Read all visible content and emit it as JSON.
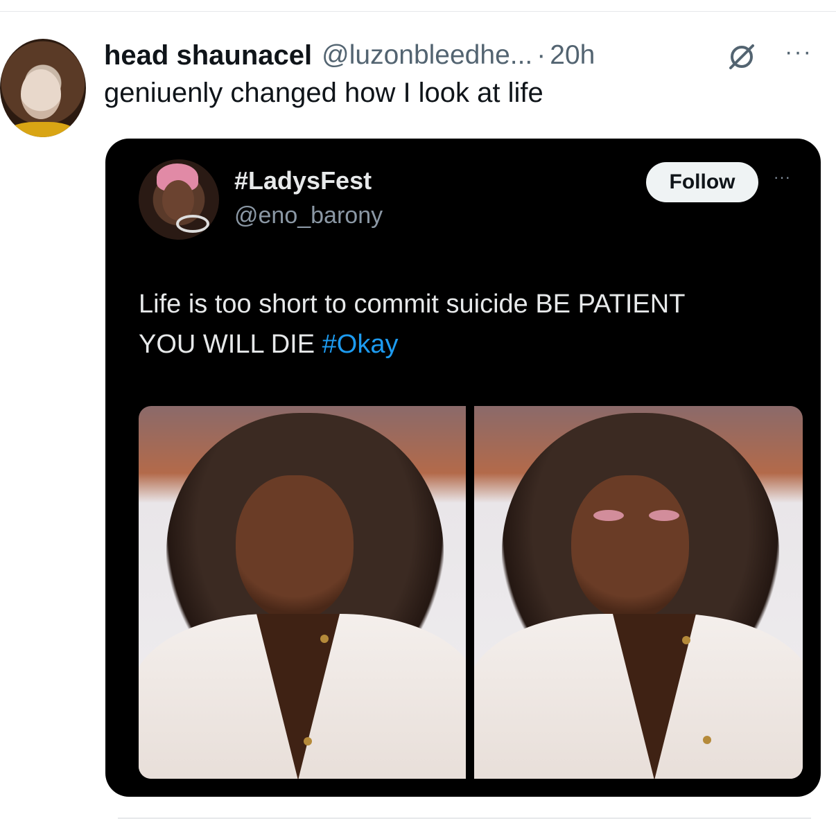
{
  "tweet": {
    "display_name": "head shaunacel",
    "handle": "@luzonbleedhe...",
    "separator": "·",
    "time": "20h",
    "text": "geniuenly changed how I look at life",
    "more_label": "···"
  },
  "quoted": {
    "display_name": "#LadysFest",
    "handle": "@eno_barony",
    "follow_label": "Follow",
    "more_label": "···",
    "text_line1": "Life is too short to commit suicide  BE PATIENT",
    "text_line2_prefix": "YOU WILL DIE ",
    "hashtag": "#Okay",
    "hashtag_color": "#1d9bf0",
    "images": [
      "photo-left",
      "photo-right"
    ]
  },
  "icons": {
    "grok": "grok-icon",
    "more": "more-icon"
  }
}
